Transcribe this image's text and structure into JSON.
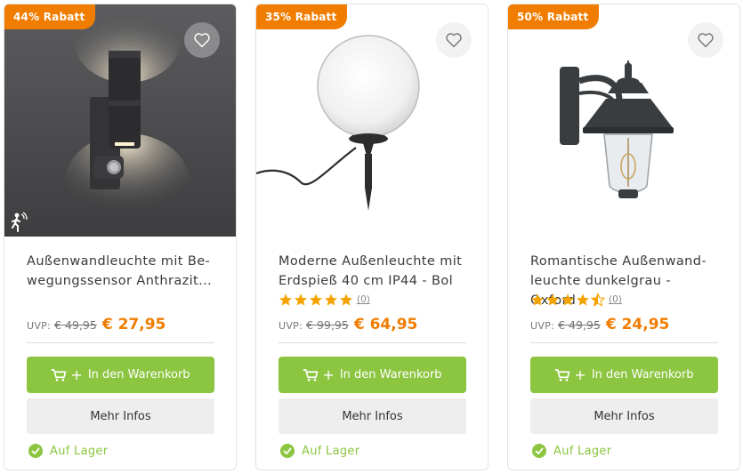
{
  "accent_colors": {
    "discount": "#f07d00",
    "cart": "#8cc540",
    "star": "#f5a300"
  },
  "products": [
    {
      "badge": "44% Rabatt",
      "title_line1": "Außenwandleuchte mit Be-",
      "title_line2": "wegungssensor Anthrazit...",
      "rating_stars": null,
      "review_count": null,
      "uvp_label": "UVP:",
      "old_price": "€ 49,95",
      "new_price": "€ 27,95",
      "cart_label": "In den Warenkorb",
      "info_label": "Mehr Infos",
      "stock_label": "Auf Lager",
      "image_icon": "motion-sensor-icon"
    },
    {
      "badge": "35% Rabatt",
      "title_line1": "Moderne Außenleuchte mit",
      "title_line2": "Erdspieß 40 cm IP44 - Bol",
      "rating_stars": 5,
      "review_count": "(0)",
      "uvp_label": "UVP:",
      "old_price": "€ 99,95",
      "new_price": "€ 64,95",
      "cart_label": "In den Warenkorb",
      "info_label": "Mehr Infos",
      "stock_label": "Auf Lager"
    },
    {
      "badge": "50% Rabatt",
      "title_line1": "Romantische Außenwand-",
      "title_line2": "leuchte dunkelgrau - Oxford",
      "rating_stars": 4.5,
      "review_count": "(0)",
      "uvp_label": "UVP:",
      "old_price": "€ 49,95",
      "new_price": "€ 24,95",
      "cart_label": "In den Warenkorb",
      "info_label": "Mehr Infos",
      "stock_label": "Auf Lager"
    }
  ]
}
